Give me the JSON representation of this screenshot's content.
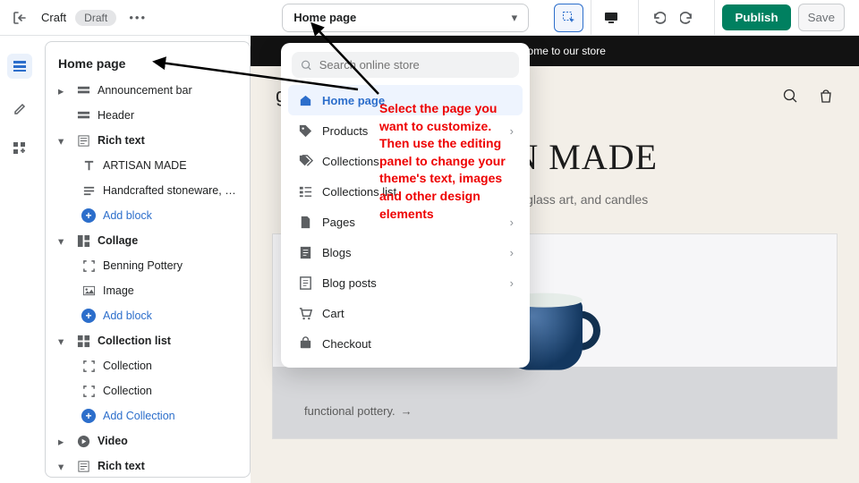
{
  "topbar": {
    "theme_name": "Craft",
    "status_pill": "Draft",
    "page_select_label": "Home page",
    "publish": "Publish",
    "save": "Save"
  },
  "sections_panel": {
    "title": "Home page",
    "items": [
      {
        "type": "row",
        "chev": "▸",
        "icon": "bar",
        "label": "Announcement bar"
      },
      {
        "type": "row",
        "chev": "",
        "icon": "bar",
        "label": "Header"
      },
      {
        "type": "row",
        "chev": "▾",
        "icon": "richtext",
        "label": "Rich text",
        "bold": true
      },
      {
        "type": "sub",
        "icon": "T",
        "label": "ARTISAN MADE"
      },
      {
        "type": "sub",
        "icon": "para",
        "label": "Handcrafted stoneware, gla..."
      },
      {
        "type": "add",
        "label": "Add block"
      },
      {
        "type": "row",
        "chev": "▾",
        "icon": "collage",
        "label": "Collage",
        "bold": true
      },
      {
        "type": "sub",
        "icon": "frame",
        "label": "Benning Pottery"
      },
      {
        "type": "sub",
        "icon": "image",
        "label": "Image"
      },
      {
        "type": "add",
        "label": "Add block"
      },
      {
        "type": "row",
        "chev": "▾",
        "icon": "grid",
        "label": "Collection list",
        "bold": true
      },
      {
        "type": "sub",
        "icon": "frame",
        "label": "Collection"
      },
      {
        "type": "sub",
        "icon": "frame",
        "label": "Collection"
      },
      {
        "type": "add",
        "label": "Add Collection"
      },
      {
        "type": "row",
        "chev": "▸",
        "icon": "play",
        "label": "Video",
        "bold": true
      },
      {
        "type": "row",
        "chev": "▾",
        "icon": "richtext",
        "label": "Rich text",
        "bold": true
      }
    ]
  },
  "dropdown": {
    "search_placeholder": "Search online store",
    "items": [
      {
        "name": "home",
        "label": "Home page",
        "selected": true,
        "chev": false
      },
      {
        "name": "products",
        "label": "Products",
        "chev": true
      },
      {
        "name": "collections",
        "label": "Collections",
        "chev": false
      },
      {
        "name": "collections-list",
        "label": "Collections list",
        "chev": false
      },
      {
        "name": "pages",
        "label": "Pages",
        "chev": true
      },
      {
        "name": "blogs",
        "label": "Blogs",
        "chev": true
      },
      {
        "name": "blog-posts",
        "label": "Blog posts",
        "chev": true
      },
      {
        "name": "cart",
        "label": "Cart",
        "chev": false
      },
      {
        "name": "checkout",
        "label": "Checkout",
        "chev": false
      }
    ]
  },
  "annotation": "Select the page you want to customize. Then use the editing panel to change your theme's text, images and other design elements",
  "preview": {
    "announcement": "Welcome to our store",
    "store_name": "gn For the Planet",
    "hero_heading": "ISAN MADE",
    "hero_sub": "stoneware, glass art, and candles",
    "caption_line": "functional pottery."
  }
}
